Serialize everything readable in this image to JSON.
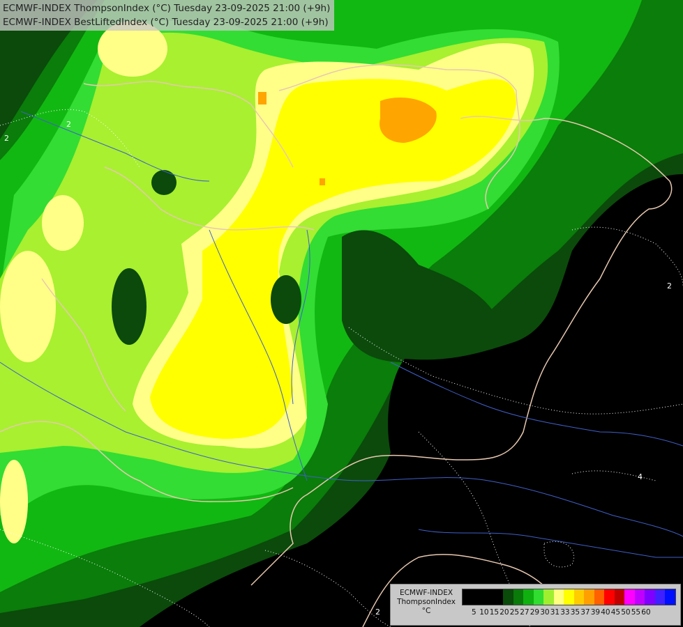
{
  "header": {
    "line1": "ECMWF-INDEX ThompsonIndex (°C) Tuesday 23-09-2025 21:00 (+9h)",
    "line2": "ECMWF-INDEX BestLiftedIndex (°C) Tuesday 23-09-2025 21:00 (+9h)"
  },
  "legend": {
    "line1": "ECMWF-INDEX",
    "line2": "ThompsonIndex",
    "line3": "°C",
    "ticks": [
      "5",
      "10",
      "15",
      "20",
      "25",
      "27",
      "29",
      "30",
      "31",
      "33",
      "35",
      "37",
      "39",
      "40",
      "45",
      "50",
      "55",
      "60"
    ],
    "colors": [
      "#000000",
      "#000000",
      "#000000",
      "#000000",
      "#0a4a0a",
      "#0a7a0a",
      "#10b010",
      "#30dd30",
      "#a0ee30",
      "#ffff80",
      "#ffff00",
      "#ffcc00",
      "#ffa000",
      "#ff6000",
      "#ff0000",
      "#c00000",
      "#ff00ff",
      "#c000ff",
      "#8000ff",
      "#4020ff",
      "#0010ff"
    ]
  },
  "contour_labels": [
    {
      "text": "2",
      "name": "contour-label-2-west"
    },
    {
      "text": "2",
      "name": "contour-label-2-northwest"
    },
    {
      "text": "2",
      "name": "contour-label-2-east"
    },
    {
      "text": "4",
      "name": "contour-label-4-southeast"
    },
    {
      "text": "2",
      "name": "contour-label-2-south"
    }
  ],
  "map_colors": {
    "black": "#000000",
    "dark_green": "#0b4a0b",
    "green": "#0a7d0a",
    "bright_green": "#12b812",
    "lime": "#33dd33",
    "yellow_green": "#a8f030",
    "pale_yellow": "#ffff88",
    "yellow": "#ffff00",
    "gold": "#ffcc00",
    "orange": "#ffa500",
    "border": "#e8c8b0",
    "river": "#4060c8"
  }
}
